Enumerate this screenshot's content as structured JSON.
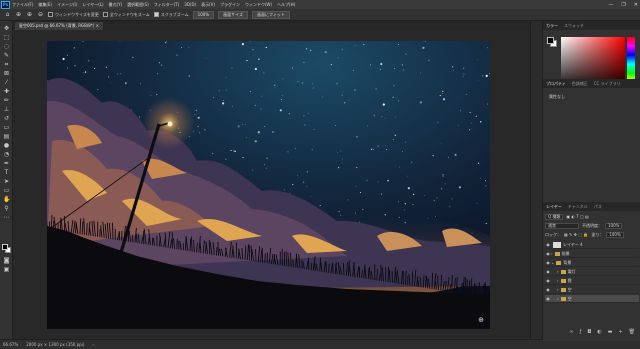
{
  "menu": {
    "logo": "Ps",
    "items": [
      "ファイル(F)",
      "編集(E)",
      "イメージ(I)",
      "レイヤー(L)",
      "書式(Y)",
      "選択範囲(S)",
      "フィルター(T)",
      "3D(D)",
      "表示(V)",
      "プラグイン",
      "ウィンドウ(W)",
      "ヘルプ(H)"
    ],
    "window_controls": [
      "—",
      "❐",
      "✕"
    ]
  },
  "options": {
    "fit_windows_label": "ウィンドウサイズを変更",
    "zoom_all_label": "全ウィンドウをズーム",
    "scrubby_zoom_label": "スクラブズーム",
    "zoom_value": "100%",
    "fit_screen_label": "画面サイズ",
    "fill_screen_label": "画面にフィット"
  },
  "document": {
    "tab_title": "星空005.psd @ 66.67% (背景, RGB/8*) ×"
  },
  "status": {
    "zoom": "66.67%",
    "dimensions": "2000 px × 1300 px (350 ppi)"
  },
  "panels": {
    "color_tabs": [
      "カラー",
      "スウォッチ"
    ],
    "props_tabs": [
      "プロパティ",
      "色調補正",
      "CC ライブラリ"
    ],
    "props_text": "属性なし",
    "layers_tabs": [
      "レイヤー",
      "チャンネル",
      "パス"
    ],
    "layer_kind": "Q 種類",
    "blend_mode": "通常",
    "opacity_label": "不透明度：",
    "opacity_value": "100%",
    "lock_label": "ロック：",
    "fill_label": "塗り：",
    "fill_value": "100%",
    "layers": [
      {
        "name": "レイヤー 4",
        "type": "pixel",
        "indent": 0
      },
      {
        "name": "前景",
        "type": "folder",
        "indent": 0
      },
      {
        "name": "背景",
        "type": "folder",
        "indent": 0
      },
      {
        "name": "電灯",
        "type": "folder",
        "indent": 1
      },
      {
        "name": "雲",
        "type": "folder",
        "indent": 1
      },
      {
        "name": "空",
        "type": "folder",
        "indent": 1
      },
      {
        "name": "空",
        "type": "folder",
        "indent": 1,
        "selected": true
      }
    ]
  },
  "colors": {
    "app_bg": "#282828",
    "accent": "#31a8ff"
  }
}
